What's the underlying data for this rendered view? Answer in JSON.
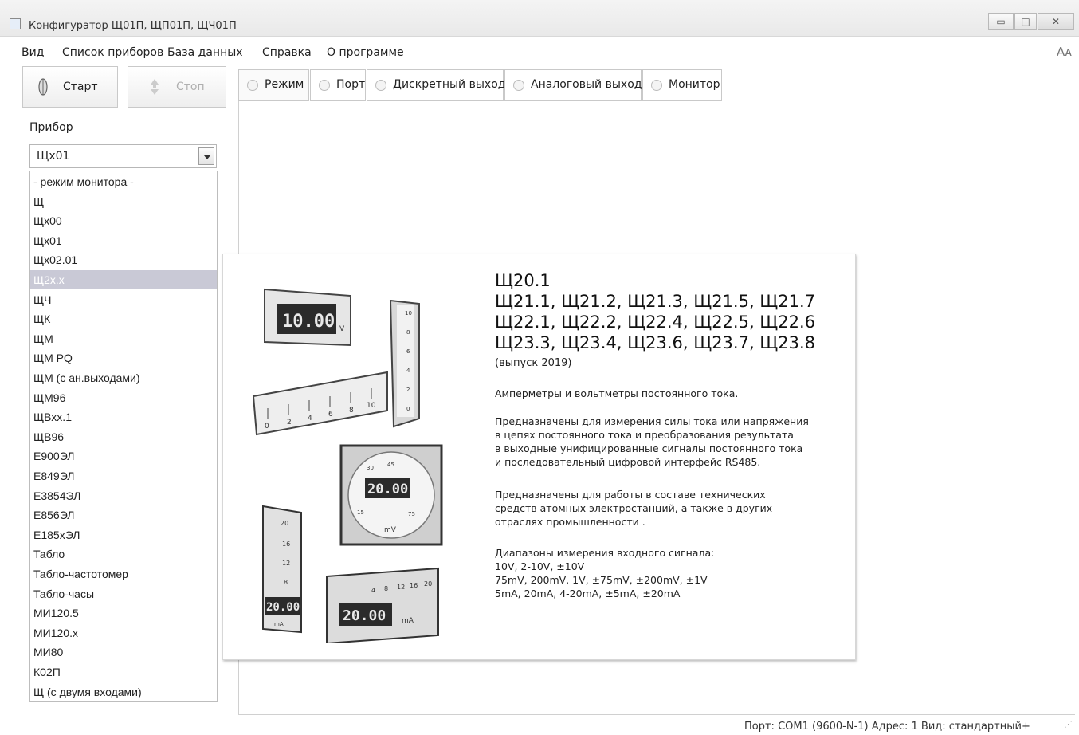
{
  "window": {
    "title": "Конфигуратор Щ01П, ЩП01П, ЩЧ01П",
    "controls": {
      "minimize": "▭",
      "maximize": "□",
      "close": "✕"
    }
  },
  "menu": {
    "items": [
      "Вид",
      "Список приборов",
      "База данных",
      "Справка",
      "О программе"
    ],
    "font_size_hint": "Aᴀ"
  },
  "toolbar": {
    "start_label": "Старт",
    "stop_label": "Стоп"
  },
  "tabs": [
    {
      "label": "Режим",
      "active": true
    },
    {
      "label": "Порт"
    },
    {
      "label": "Дискретный выход"
    },
    {
      "label": "Аналоговый выход"
    },
    {
      "label": "Монитор"
    }
  ],
  "device": {
    "label": "Прибор",
    "selected_value": "Щх01",
    "list": [
      "- режим монитора -",
      "Щ",
      "Щх00",
      "Щх01",
      "Щх02.01",
      "Щ2х.х",
      "ЩЧ",
      "ЩК",
      "ЩМ",
      "ЩМ PQ",
      "ЩМ (с ан.выходами)",
      "ЩМ96",
      "ЩВхх.1",
      "ЩВ96",
      "Е900ЭЛ",
      "Е849ЭЛ",
      "Е3854ЭЛ",
      "Е856ЭЛ",
      "Е185хЭЛ",
      "Табло",
      "Табло-частотомер",
      "Табло-часы",
      "МИ120.5",
      "МИ120.х",
      "МИ80",
      "К02П",
      "Щ (с двумя входами)"
    ],
    "highlighted": "Щ2х.х"
  },
  "info": {
    "title": "Щ20.1",
    "models": [
      "Щ21.1, Щ21.2, Щ21.3, Щ21.5, Щ21.7",
      "Щ22.1, Щ22.2, Щ22.4, Щ22.5, Щ22.6",
      "Щ23.3, Щ23.4, Щ23.6, Щ23.7, Щ23.8"
    ],
    "release": "(выпуск 2019)",
    "summary": "Амперметры и вольтметры постоянного тока.",
    "purpose": "Предназначены для измерения силы тока или напряжения\nв цепях постоянного тока и преобразования результата\nв выходные унифицированные сигналы постоянного тока\nи последовательный цифровой интерфейс RS485.",
    "usage": "Предназначены для работы в составе технических\nсредств атомных электростанций, а также в других\nотраслях промышленности .",
    "ranges": "Диапазоны измерения входного сигнала:\n10V, 2-10V, ±10V\n75mV, 200mV, 1V, ±75mV, ±200mV, ±1V\n5mA, 20mA, 4-20mA, ±5mA, ±20mA",
    "photo": {
      "top_meter_display": "10.00",
      "top_meter_unit": "V",
      "scale_ticks": [
        "0",
        "2",
        "4",
        "6",
        "8",
        "10"
      ],
      "vertical_scale_ticks": [
        "10",
        "8",
        "6",
        "4",
        "2",
        "0"
      ],
      "round_meter_display": "20.00",
      "round_meter_unit": "mV",
      "round_meter_ticks": [
        "30",
        "45",
        "15",
        "75"
      ],
      "bottom_left_ticks": [
        "20",
        "16",
        "12",
        "8"
      ],
      "bottom_left_display": "20.00",
      "bottom_unit": "mA",
      "bottom_right_display": "20.00",
      "bottom_right_ticks": [
        "4",
        "8",
        "12",
        "16",
        "20"
      ]
    }
  },
  "status": {
    "text": "Порт: COM1 (9600-N-1)   Адрес: 1   Вид: стандартный+"
  }
}
